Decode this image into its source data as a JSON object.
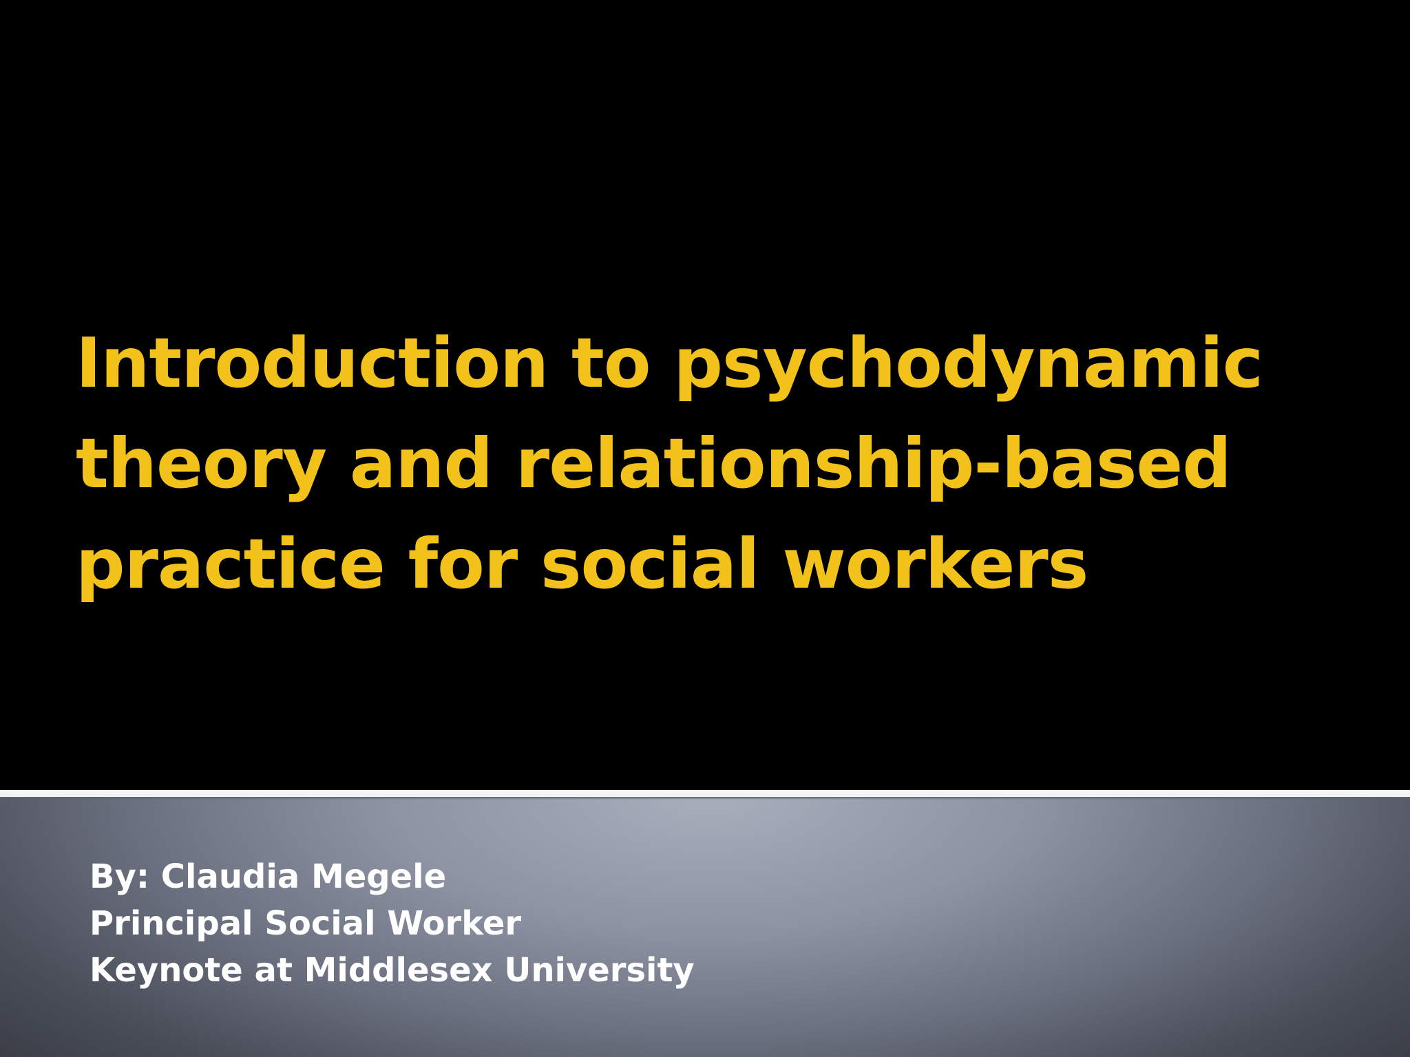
{
  "slide": {
    "title_lines": [
      "Introduction to psychodynamic",
      "theory and relationship-based",
      "practice for social workers"
    ],
    "subtitle_lines": [
      "By: Claudia Megele",
      "Principal Social Worker",
      "Keynote at Middlesex University"
    ]
  },
  "colors": {
    "title_background": "#000000",
    "title_text": "#f2c21a",
    "subtitle_text": "#ffffff",
    "divider": "#f4f4f4",
    "subtitle_background_center": "#a9aebd",
    "subtitle_background_edge": "#3d4049"
  }
}
